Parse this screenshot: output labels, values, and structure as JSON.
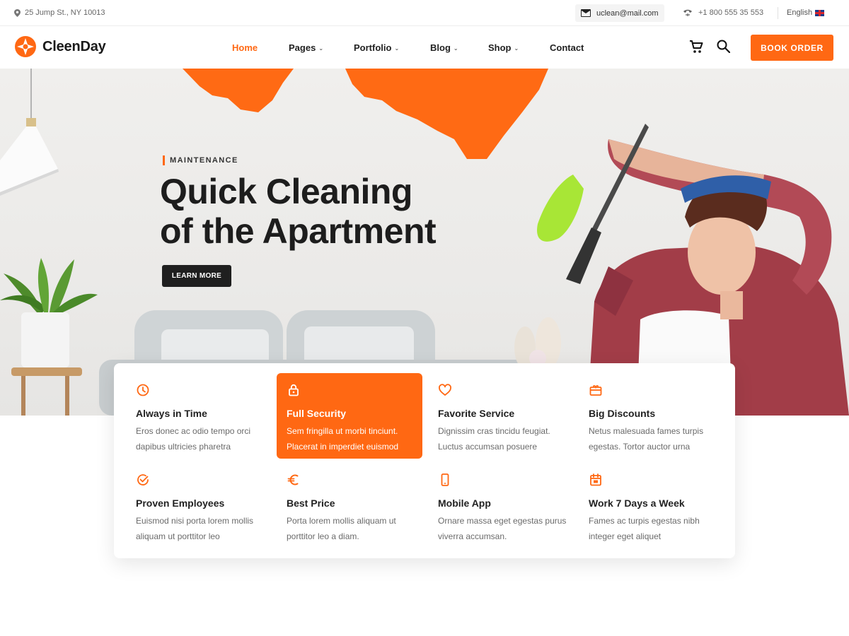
{
  "topbar": {
    "address": "25 Jump St., NY 10013",
    "email": "uclean@mail.com",
    "phone": "+1 800 555 35 553",
    "language": "English"
  },
  "header": {
    "logo_text": "CleenDay",
    "nav": [
      {
        "label": "Home",
        "active": true
      },
      {
        "label": "Pages",
        "dropdown": true
      },
      {
        "label": "Portfolio",
        "dropdown": true
      },
      {
        "label": "Blog",
        "dropdown": true
      },
      {
        "label": "Shop",
        "dropdown": true
      },
      {
        "label": "Contact"
      }
    ],
    "book_button": "BOOK ORDER"
  },
  "hero": {
    "eyebrow": "MAINTENANCE",
    "title_line1": "Quick Cleaning",
    "title_line2": "of the Apartment",
    "button": "LEARN MORE"
  },
  "features": [
    {
      "icon": "clock-icon",
      "title": "Always in Time",
      "desc": "Eros donec ac odio tempo orci dapibus ultricies pharetra"
    },
    {
      "icon": "lock-icon",
      "title": "Full Security",
      "desc": "Sem fringilla ut morbi tinciunt. Placerat in imperdiet euismod",
      "highlight": true
    },
    {
      "icon": "heart-icon",
      "title": "Favorite Service",
      "desc": "Dignissim cras tincidu feugiat. Luctus accumsan posuere"
    },
    {
      "icon": "gift-card-icon",
      "title": "Big Discounts",
      "desc": "Netus malesuada fames turpis egestas. Tortor auctor urna"
    },
    {
      "icon": "check-circle-icon",
      "title": "Proven Employees",
      "desc": "Euismod nisi porta lorem mollis aliquam ut porttitor leo"
    },
    {
      "icon": "euro-icon",
      "title": "Best Price",
      "desc": "Porta lorem mollis aliquam ut porttitor leo a diam."
    },
    {
      "icon": "mobile-icon",
      "title": "Mobile App",
      "desc": "Ornare massa eget egestas purus viverra accumsan."
    },
    {
      "icon": "calendar-icon",
      "title": "Work 7 Days a Week",
      "desc": "Fames ac turpis egestas nibh integer eget aliquet"
    }
  ],
  "colors": {
    "accent": "#ff6813",
    "dark": "#1f1f1f",
    "text_muted": "#6b6b6b"
  }
}
